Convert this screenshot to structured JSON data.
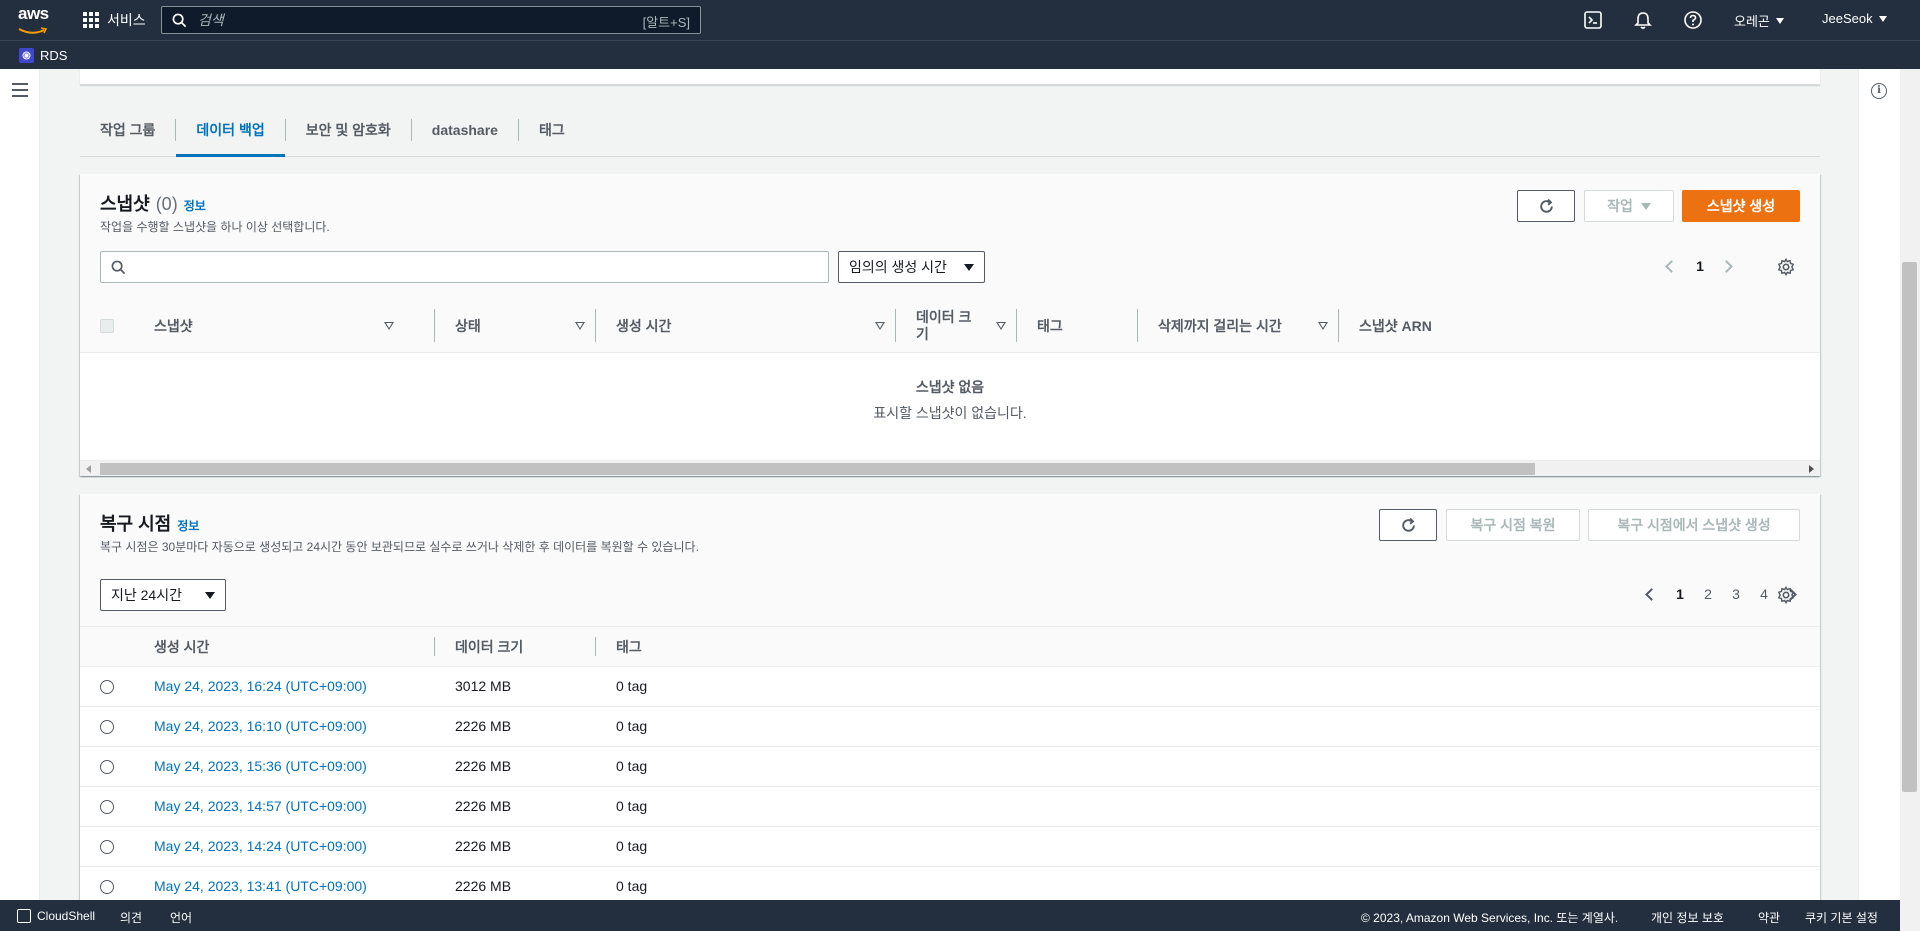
{
  "topnav": {
    "logo_text": "aws",
    "services_label": "서비스",
    "search_placeholder": "검색",
    "search_shortcut": "[알트+S]",
    "region_label": "오레곤",
    "user_label": "JeeSeok",
    "icons": [
      "cloudshell-icon",
      "bell-icon",
      "help-icon"
    ]
  },
  "subnav": {
    "service_label": "RDS"
  },
  "tabs": [
    {
      "label": "작업 그룹",
      "active": false
    },
    {
      "label": "데이터 백업",
      "active": true
    },
    {
      "label": "보안 및 암호화",
      "active": false
    },
    {
      "label": "datashare",
      "active": false
    },
    {
      "label": "태그",
      "active": false
    }
  ],
  "snapshots": {
    "title": "스냅샷",
    "count": "(0)",
    "info_label": "정보",
    "description": "작업을 수행할 스냅샷을 하나 이상 선택합니다.",
    "actions_label": "작업",
    "create_label": "스냅샷 생성",
    "search_value": "",
    "filter_select": "임의의 생성 시간",
    "page": "1",
    "columns": [
      "스냅샷",
      "상태",
      "생성 시간",
      "데이터 크기",
      "태그",
      "삭제까지 걸리는 시간",
      "스냅샷 ARN"
    ],
    "empty_title": "스냅샷 없음",
    "empty_subtitle": "표시할 스냅샷이 없습니다."
  },
  "restore": {
    "title": "복구 시점",
    "info_label": "정보",
    "description": "복구 시점은 30분마다 자동으로 생성되고 24시간 동안 보관되므로 실수로 쓰거나 삭제한 후 데이터를 복원할 수 있습니다.",
    "restore_button": "복구 시점 복원",
    "create_snapshot_button": "복구 시점에서 스냅샷 생성",
    "range_select": "지난 24시간",
    "pages": [
      "1",
      "2",
      "3",
      "4"
    ],
    "current_page": "1",
    "columns": [
      "생성 시간",
      "데이터 크기",
      "태그"
    ],
    "rows": [
      {
        "time": "May 24, 2023, 16:24 (UTC+09:00)",
        "size": "3012 MB",
        "tags": "0 tag"
      },
      {
        "time": "May 24, 2023, 16:10 (UTC+09:00)",
        "size": "2226 MB",
        "tags": "0 tag"
      },
      {
        "time": "May 24, 2023, 15:36 (UTC+09:00)",
        "size": "2226 MB",
        "tags": "0 tag"
      },
      {
        "time": "May 24, 2023, 14:57 (UTC+09:00)",
        "size": "2226 MB",
        "tags": "0 tag"
      },
      {
        "time": "May 24, 2023, 14:24 (UTC+09:00)",
        "size": "2226 MB",
        "tags": "0 tag"
      },
      {
        "time": "May 24, 2023, 13:41 (UTC+09:00)",
        "size": "2226 MB",
        "tags": "0 tag"
      }
    ]
  },
  "footer": {
    "cloudshell": "CloudShell",
    "feedback": "의견",
    "language": "언어",
    "copyright": "© 2023, Amazon Web Services, Inc. 또는 계열사.",
    "privacy": "개인 정보 보호",
    "terms": "약관",
    "cookies": "쿠키 기본 설정"
  },
  "colors": {
    "nav_bg": "#232f3e",
    "link": "#0073bb",
    "primary": "#ec7211"
  }
}
